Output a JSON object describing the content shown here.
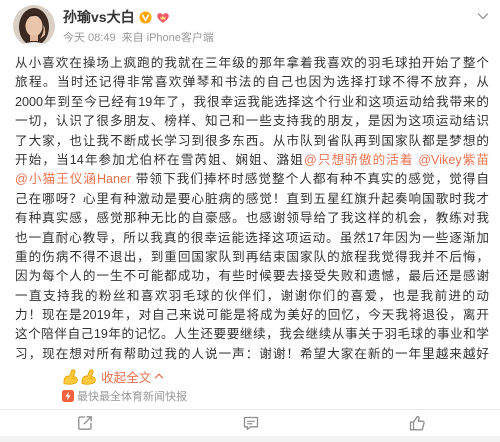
{
  "post": {
    "author": {
      "name": "孙瑜vs大白"
    },
    "meta": {
      "time": "今天 08:49",
      "source": "来自 iPhone客户端"
    },
    "body_lines": [
      [
        "从小喜欢在操场上疯跑的我就在三年级的那年拿着我喜欢的羽毛球拍开始了整个"
      ],
      [
        "旅程。当时还记得非常喜欢弹琴和书法的自己也因为选择打球不得不放弃，从"
      ],
      [
        "2000年到至今已经有19年了，我很幸运我能选择这个行业和这项运动给我带来的"
      ],
      [
        "一切，认识了很多朋友、榜样、知己和一些支持我的朋友，是因为这项运动结识"
      ],
      [
        "了大家，也让我不断成长学习到很多东西。从市队到省队再到国家队都是梦想的"
      ],
      [
        "开始，当14年参加尤伯杯在雪芮姐、娴姐、潞姐",
        {
          "mention": "@只想骄傲的活着"
        },
        " ",
        {
          "mention": "@Vikey紫苗"
        }
      ],
      [
        {
          "mention": "@小猫王仪涵Haner"
        },
        " 带领下我们捧杯时感觉整个人都有种不真实的感觉，觉得自"
      ],
      [
        "己在哪呀？心里有种激动是要心脏病的感觉！直到五星红旗升起奏响国歌时我才"
      ],
      [
        "有种真实感，感觉那种无比的自豪感。也感谢领导给了我这样的机会，教练对我"
      ],
      [
        "也一直耐心教导，所以我真的很幸运能选择这项运动。虽然17年因为一些逐渐加"
      ],
      [
        "重的伤病不得不退出，到重回国家队到再结束国家队的旅程我觉得我并不后悔，"
      ],
      [
        "因为每个人的一生不可能都成功，有些时候要去接受失败和遗憾，最后还是感谢"
      ],
      [
        "一直支持我的粉丝和喜欢羽毛球的伙伴们，谢谢你们的喜爱，也是我前进的动"
      ],
      [
        "力！现在是2019年，对自己来说可能是将成为美好的回忆，今天我将退役，离开"
      ],
      [
        "这个陪伴自己19年的记忆。人生还要要继续，我会继续从事关于羽毛球的事业和学"
      ],
      [
        "习，现在想对所有帮助过我的人说一声：谢谢！希望大家在新的一年里越来越好"
      ]
    ],
    "emojis": [
      "flexed-arm-icon",
      "flexed-arm-icon"
    ],
    "collapse_label": "收起全文",
    "tag": "最快最全体育新闻快报"
  },
  "icons": {
    "more": "chevron-down-icon",
    "verified": "verified-badge-icon",
    "member": "member-icon",
    "collapse": "chevron-up-icon",
    "tag": "lightning-icon",
    "actions": [
      "share-icon",
      "comment-icon",
      "like-icon"
    ]
  },
  "colors": {
    "text": "#333333",
    "link": "#eb7350",
    "meta": "#999999",
    "badge": "#ffa600",
    "divider": "#e8e8e8"
  }
}
